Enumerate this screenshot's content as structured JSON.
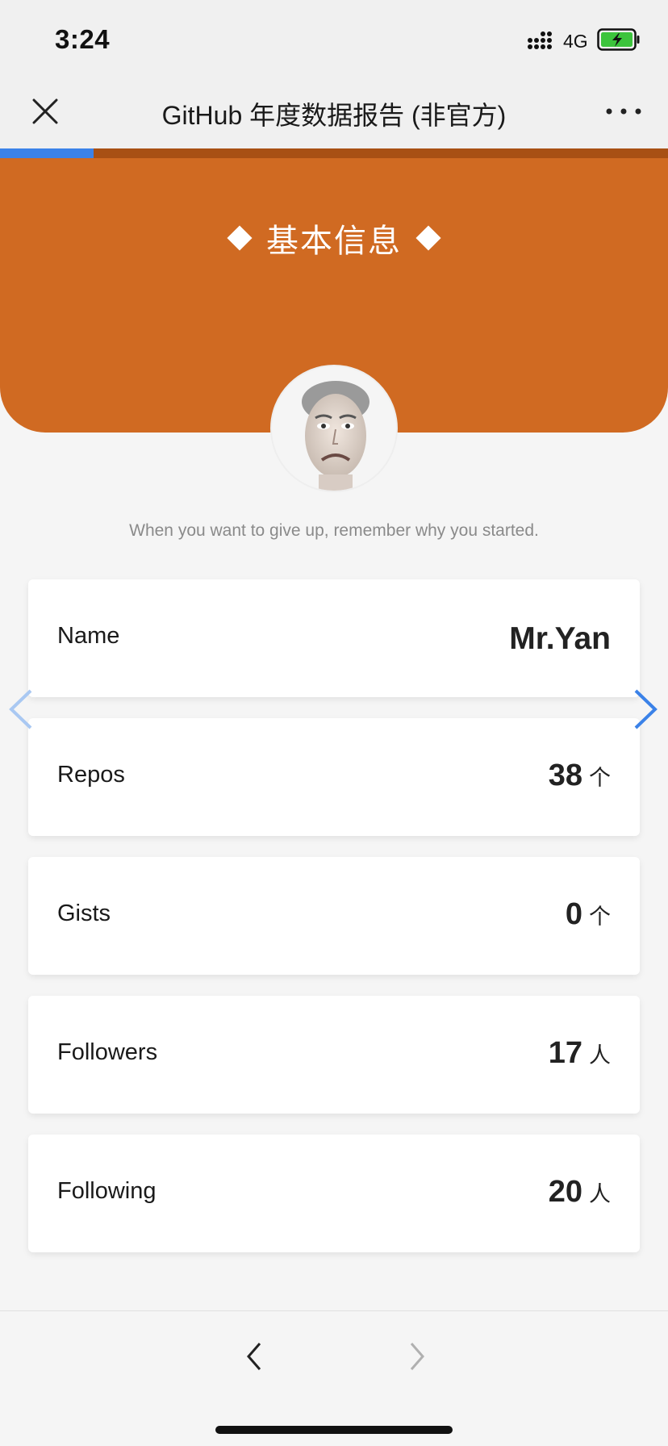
{
  "status_bar": {
    "time": "3:24",
    "network": "4G",
    "battery_color": "#3cc43c"
  },
  "nav": {
    "title": "GitHub 年度数据报告 (非官方)",
    "close_icon": "close-icon",
    "more_icon": "more-icon"
  },
  "progress": {
    "value": 0.14,
    "accent": "#3b82e8"
  },
  "header": {
    "title": "基本信息",
    "background": "#d06a22"
  },
  "profile": {
    "motto": "When you want to give up, remember why you started."
  },
  "stats": [
    {
      "label": "Name",
      "value": "Mr.Yan",
      "unit": ""
    },
    {
      "label": "Repos",
      "value": "38",
      "unit": "个"
    },
    {
      "label": "Gists",
      "value": "0",
      "unit": "个"
    },
    {
      "label": "Followers",
      "value": "17",
      "unit": "人"
    },
    {
      "label": "Following",
      "value": "20",
      "unit": "人"
    }
  ],
  "navigation": {
    "left_arrow_color": "#a9c8f2",
    "right_arrow_color": "#3b82e8"
  }
}
